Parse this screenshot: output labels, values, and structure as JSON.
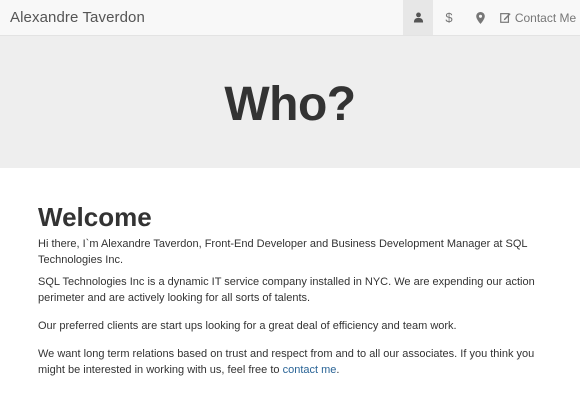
{
  "navbar": {
    "brand": "Alexandre Taverdon",
    "items": [
      {
        "icon": "user-icon",
        "active": true
      },
      {
        "icon": "dollar-icon",
        "text": "$"
      },
      {
        "icon": "map-marker-icon"
      },
      {
        "icon": "edit-icon",
        "label": "Contact Me"
      }
    ]
  },
  "hero": {
    "title": "Who?"
  },
  "main": {
    "heading": "Welcome",
    "p1": "Hi there, I`m Alexandre Taverdon, Front-End Developer and Business Development Manager at SQL Technologies Inc.",
    "p2": "SQL Technologies Inc is a dynamic IT service company installed in NYC. We are expending our action perimeter and are actively looking for all sorts of talents.",
    "p3": "Our preferred clients are start ups looking for a great deal of efficiency and team work.",
    "p4_text": "We want long term relations based on trust and respect from and to all our associates. If you think you might be interested in working with us, feel free to ",
    "p4_link": "contact me",
    "p4_end": "."
  },
  "colors": {
    "link": "#2a6496",
    "navbar_bg": "#f8f8f8",
    "hero_bg": "#eeeeee",
    "active_nav_bg": "#e7e7e7"
  }
}
